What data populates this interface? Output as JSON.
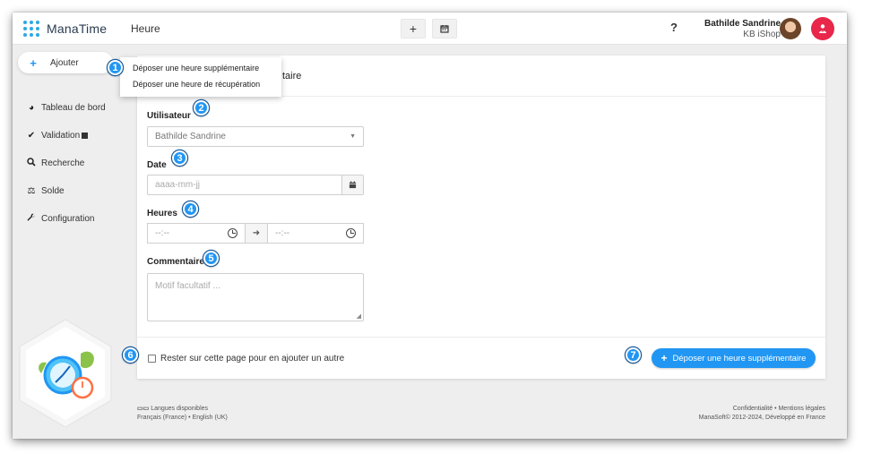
{
  "app": {
    "logo_text": "ManaTime",
    "page_title": "Heure"
  },
  "header": {
    "add_label": "+",
    "calendar_icon": "calendar-icon",
    "help_label": "?",
    "user_name": "Bathilde Sandrine",
    "user_company": "KB iShop",
    "logout_icon": "user-power-icon"
  },
  "sidebar": {
    "add_label": "Ajouter",
    "items": [
      {
        "label": "Tableau de bord",
        "icon": "pie-chart-icon"
      },
      {
        "label": "Validation",
        "icon": "check-icon"
      },
      {
        "label": "Recherche",
        "icon": "search-icon"
      },
      {
        "label": "Solde",
        "icon": "balance-scale-icon"
      },
      {
        "label": "Configuration",
        "icon": "wrench-icon"
      }
    ]
  },
  "dropdown": {
    "items": [
      {
        "label": "Déposer une heure supplémentaire"
      },
      {
        "label": "Déposer une heure de récupération"
      }
    ]
  },
  "form": {
    "header_suffix": "taire",
    "user_label": "Utilisateur",
    "user_value": "Bathilde Sandrine",
    "date_label": "Date",
    "date_placeholder": "aaaa-mm-jj",
    "hours_label": "Heures",
    "time_start": "--:--",
    "time_end": "--:--",
    "comment_label": "Commentaire",
    "comment_placeholder": "Motif facultatif ...",
    "stay_label": "Rester sur cette page pour en ajouter un autre",
    "submit_label": "Déposer une heure supplémentaire"
  },
  "footer": {
    "languages_title": "Langues disponibles",
    "lang_fr": "Français (France)",
    "lang_sep": " • ",
    "lang_en": "English (UK)",
    "privacy": "Confidentialité",
    "legal_sep": " • ",
    "legal": "Mentions légales",
    "copyright": "ManaSoft© 2012-2024, Développé en France"
  },
  "callouts": [
    "1",
    "2",
    "3",
    "4",
    "5",
    "6",
    "7"
  ],
  "colors": {
    "accent": "#2196f3",
    "logout": "#e8274a",
    "sidebar_bg": "#eeeeee"
  }
}
